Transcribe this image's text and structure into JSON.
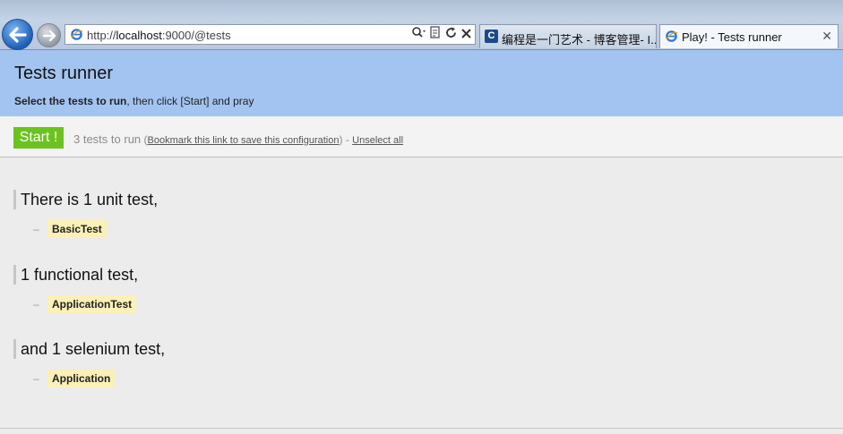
{
  "browser": {
    "url_prefix": "http://",
    "url_host": "localhost",
    "url_rest": ":9000/@tests",
    "tabs": [
      {
        "label": "编程是一门艺术 - 博客管理- I..."
      },
      {
        "label": "Play! - Tests runner"
      }
    ],
    "tab_close": "✕"
  },
  "header": {
    "title": "Tests runner",
    "subtitle_bold": "Select the tests to run",
    "subtitle_rest": ", then click [Start] and pray"
  },
  "toolbar": {
    "start_label": "Start !",
    "count_text": "3 tests to run",
    "paren_open": " (",
    "bookmark_link": "Bookmark this link to save this configuration",
    "paren_close": ") - ",
    "unselect_link": "Unselect all"
  },
  "groups": [
    {
      "title": "There is 1 unit test,",
      "tests": [
        "BasicTest"
      ]
    },
    {
      "title": "1 functional test,",
      "tests": [
        "ApplicationTest"
      ]
    },
    {
      "title": "and 1 selenium test,",
      "tests": [
        "Application"
      ]
    }
  ],
  "dash": "–"
}
